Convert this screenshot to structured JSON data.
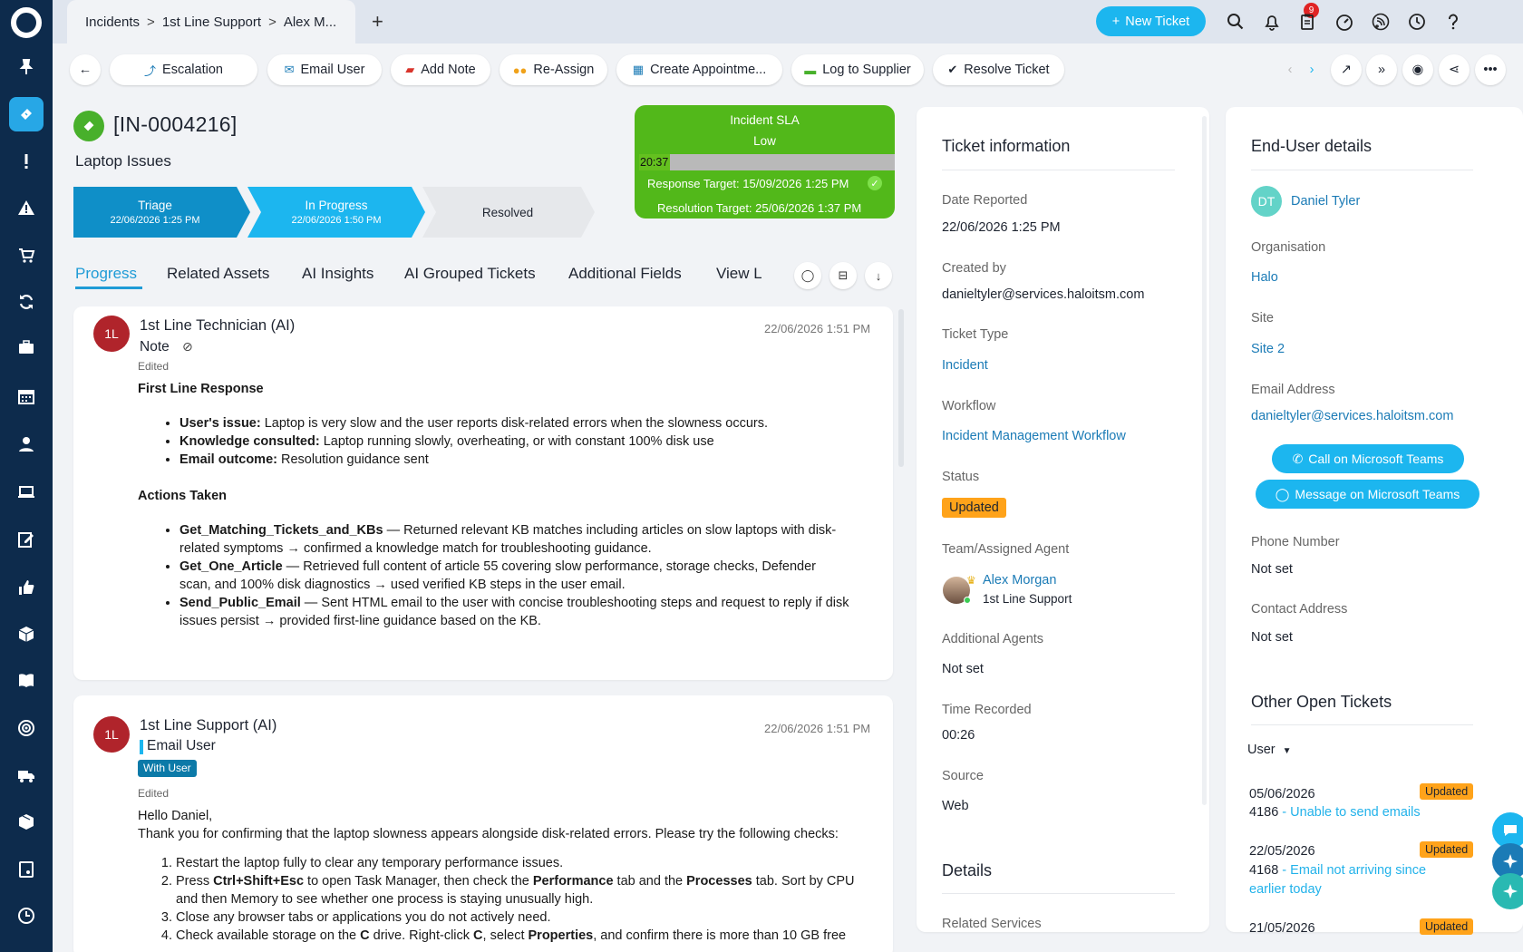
{
  "breadcrumb": {
    "items": [
      "Incidents",
      "1st Line Support",
      "Alex M..."
    ]
  },
  "header": {
    "new_ticket_label": "New Ticket",
    "notification_count": "9"
  },
  "toolbar": {
    "escalation": "Escalation",
    "email_user": "Email User",
    "add_note": "Add Note",
    "reassign": "Re-Assign",
    "create_appointment": "Create Appointme...",
    "log_to_supplier": "Log to Supplier",
    "resolve_ticket": "Resolve Ticket"
  },
  "ticket": {
    "id": "[IN-0004216]",
    "summary": "Laptop Issues"
  },
  "stages": [
    {
      "name": "Triage",
      "date": "22/06/2026 1:25 PM"
    },
    {
      "name": "In Progress",
      "date": "22/06/2026 1:50 PM"
    },
    {
      "name": "Resolved",
      "date": ""
    }
  ],
  "sla": {
    "title": "Incident SLA",
    "priority": "Low",
    "elapsed": "20:37",
    "progress": 0.12,
    "response_target": "Response Target: 15/09/2026 1:25 PM",
    "resolution_target": "Resolution Target: 25/06/2026 1:37 PM",
    "color": "#52b81a"
  },
  "tabs": [
    "Progress",
    "Related Assets",
    "AI Insights",
    "AI Grouped Tickets",
    "Additional Fields",
    "View L"
  ],
  "notes": [
    {
      "initials": "1L",
      "author": "1st Line Technician (AI)",
      "type": "Note",
      "time": "22/06/2026 1:51 PM",
      "edited": "Edited",
      "heading1": "First Line Response",
      "bullets1": [
        {
          "label": "User's issue:",
          "text": " Laptop is very slow and the user reports disk-related errors when the slowness occurs."
        },
        {
          "label": "Knowledge consulted:",
          "text": " Laptop running slowly, overheating, or with constant 100% disk use"
        },
        {
          "label": "Email outcome:",
          "text": " Resolution guidance sent"
        }
      ],
      "heading2": "Actions Taken",
      "bullets2": [
        {
          "label": "Get_Matching_Tickets_and_KBs",
          "text": " — Returned relevant KB matches including articles on slow laptops with disk-related symptoms → confirmed a knowledge match for troubleshooting guidance."
        },
        {
          "label": "Get_One_Article",
          "text": " — Retrieved full content of article 55 covering slow performance, storage checks, Defender scan, and 100% disk diagnostics → used verified KB steps in the user email."
        },
        {
          "label": "Send_Public_Email",
          "text": " — Sent HTML email to the user with concise troubleshooting steps and request to reply if disk issues persist → provided first-line guidance based on the KB."
        }
      ]
    },
    {
      "initials": "1L",
      "author": "1st Line Support (AI)",
      "type": "Email User",
      "badge": "With User",
      "time": "22/06/2026 1:51 PM",
      "edited": "Edited",
      "greeting": "Hello Daniel,",
      "intro": "Thank you for confirming that the laptop slowness appears alongside disk-related errors. Please try the following checks:",
      "step1": "Restart the laptop fully to clear any temporary performance issues.",
      "step2_a": "Press ",
      "step2_b": "Ctrl+Shift+Esc",
      "step2_c": " to open Task Manager, then check the ",
      "step2_d": "Performance",
      "step2_e": " tab and the ",
      "step2_f": "Processes",
      "step2_g": " tab. Sort by CPU and then Memory to see whether one process is staying unusually high.",
      "step3": "Close any browser tabs or applications you do not actively need.",
      "step4_a": "Check available storage on the ",
      "step4_b": "C",
      "step4_c": " drive. Right-click ",
      "step4_d": "C",
      "step4_e": ", select ",
      "step4_f": "Properties",
      "step4_g": ", and confirm there is more than 10 GB free"
    }
  ],
  "ticket_info": {
    "title": "Ticket information",
    "date_reported_label": "Date Reported",
    "date_reported": "22/06/2026 1:25 PM",
    "created_by_label": "Created by",
    "created_by": "danieltyler@services.haloitsm.com",
    "ticket_type_label": "Ticket Type",
    "ticket_type": "Incident",
    "workflow_label": "Workflow",
    "workflow": "Incident Management Workflow",
    "status_label": "Status",
    "status": "Updated",
    "team_label": "Team/Assigned Agent",
    "agent": "Alex Morgan",
    "team": "1st Line Support",
    "additional_agents_label": "Additional Agents",
    "additional_agents": "Not set",
    "time_recorded_label": "Time Recorded",
    "time_recorded": "00:26",
    "source_label": "Source",
    "source": "Web",
    "details_title": "Details",
    "related_services_label": "Related Services"
  },
  "end_user": {
    "title": "End-User details",
    "initials": "DT",
    "name": "Daniel Tyler",
    "organisation_label": "Organisation",
    "organisation": "Halo",
    "site_label": "Site",
    "site": "Site 2",
    "email_label": "Email Address",
    "email": "danieltyler@services.haloitsm.com",
    "call_teams": "Call on Microsoft Teams",
    "message_teams": "Message on Microsoft Teams",
    "phone_label": "Phone Number",
    "phone": "Not set",
    "contact_label": "Contact Address",
    "contact": "Not set"
  },
  "other_tickets": {
    "title": "Other Open Tickets",
    "filter": "User",
    "items": [
      {
        "date": "05/06/2026",
        "number": "4186",
        "subject": "- Unable to send emails",
        "status": "Updated"
      },
      {
        "date": "22/05/2026",
        "number": "4168",
        "subject": "- Email not arriving since earlier today",
        "status": "Updated"
      },
      {
        "date": "21/05/2026",
        "number": "",
        "subject": "",
        "status": "Updated"
      }
    ]
  },
  "colors": {
    "accent": "#1cb6ef",
    "sidebar": "#0d2b4c",
    "status_updated": "#ffa31a",
    "avatar_red": "#b0242b"
  }
}
